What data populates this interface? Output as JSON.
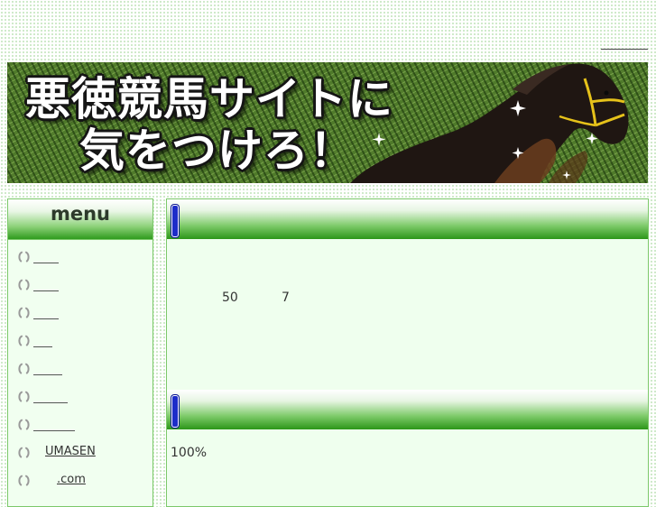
{
  "banner": {
    "line1": "悪徳競馬サイトに",
    "line2": "気をつけろ！"
  },
  "sidebar": {
    "title": "menu",
    "items": [
      {
        "label": ""
      },
      {
        "label": ""
      },
      {
        "label": ""
      },
      {
        "label": ""
      },
      {
        "label": ""
      },
      {
        "label": ""
      },
      {
        "label": ""
      },
      {
        "label": "UMASEN"
      },
      {
        "label": ".com"
      }
    ]
  },
  "main": {
    "section1": {
      "numbers": [
        "50",
        "7"
      ]
    },
    "section2": {
      "text": "100%"
    }
  },
  "colors": {
    "accent_green": "#2c9619",
    "border_green": "#7cc96a",
    "panel_bg": "#efffee",
    "heading_tick": "#1d2cc9"
  },
  "icons": {
    "menu_bullet": "horseshoe-icon",
    "section_marker": "blue-bar-icon"
  }
}
